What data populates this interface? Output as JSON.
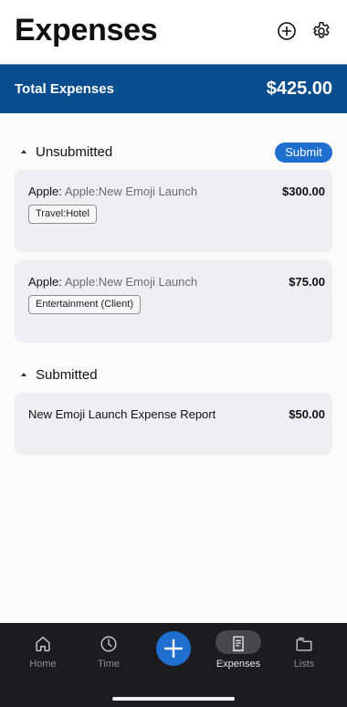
{
  "header": {
    "title": "Expenses",
    "icons": [
      "add-circle-icon",
      "gear-icon"
    ]
  },
  "total": {
    "label": "Total Expenses",
    "value": "$425.00"
  },
  "unsubmitted": {
    "title": "Unsubmitted",
    "submit_label": "Submit",
    "items": [
      {
        "merchant": "Apple:",
        "project": "Apple:New Emoji Launch",
        "amount": "$300.00",
        "tag": "Travel:Hotel"
      },
      {
        "merchant": "Apple:",
        "project": "Apple:New Emoji Launch",
        "amount": "$75.00",
        "tag": "Entertainment (Client)"
      }
    ]
  },
  "submitted": {
    "title": "Submitted",
    "items": [
      {
        "title": "New Emoji Launch Expense Report",
        "amount": "$50.00"
      }
    ]
  },
  "tabbar": {
    "tabs": [
      {
        "label": "Home",
        "icon": "home-icon"
      },
      {
        "label": "Time",
        "icon": "clock-icon"
      },
      {
        "label": "Expenses",
        "icon": "receipt-icon",
        "active": true
      },
      {
        "label": "Lists",
        "icon": "folder-icon"
      }
    ],
    "fab_icon": "plus-icon",
    "accent": "#1f6fd1",
    "header_bar_color": "#0a4d8f"
  }
}
